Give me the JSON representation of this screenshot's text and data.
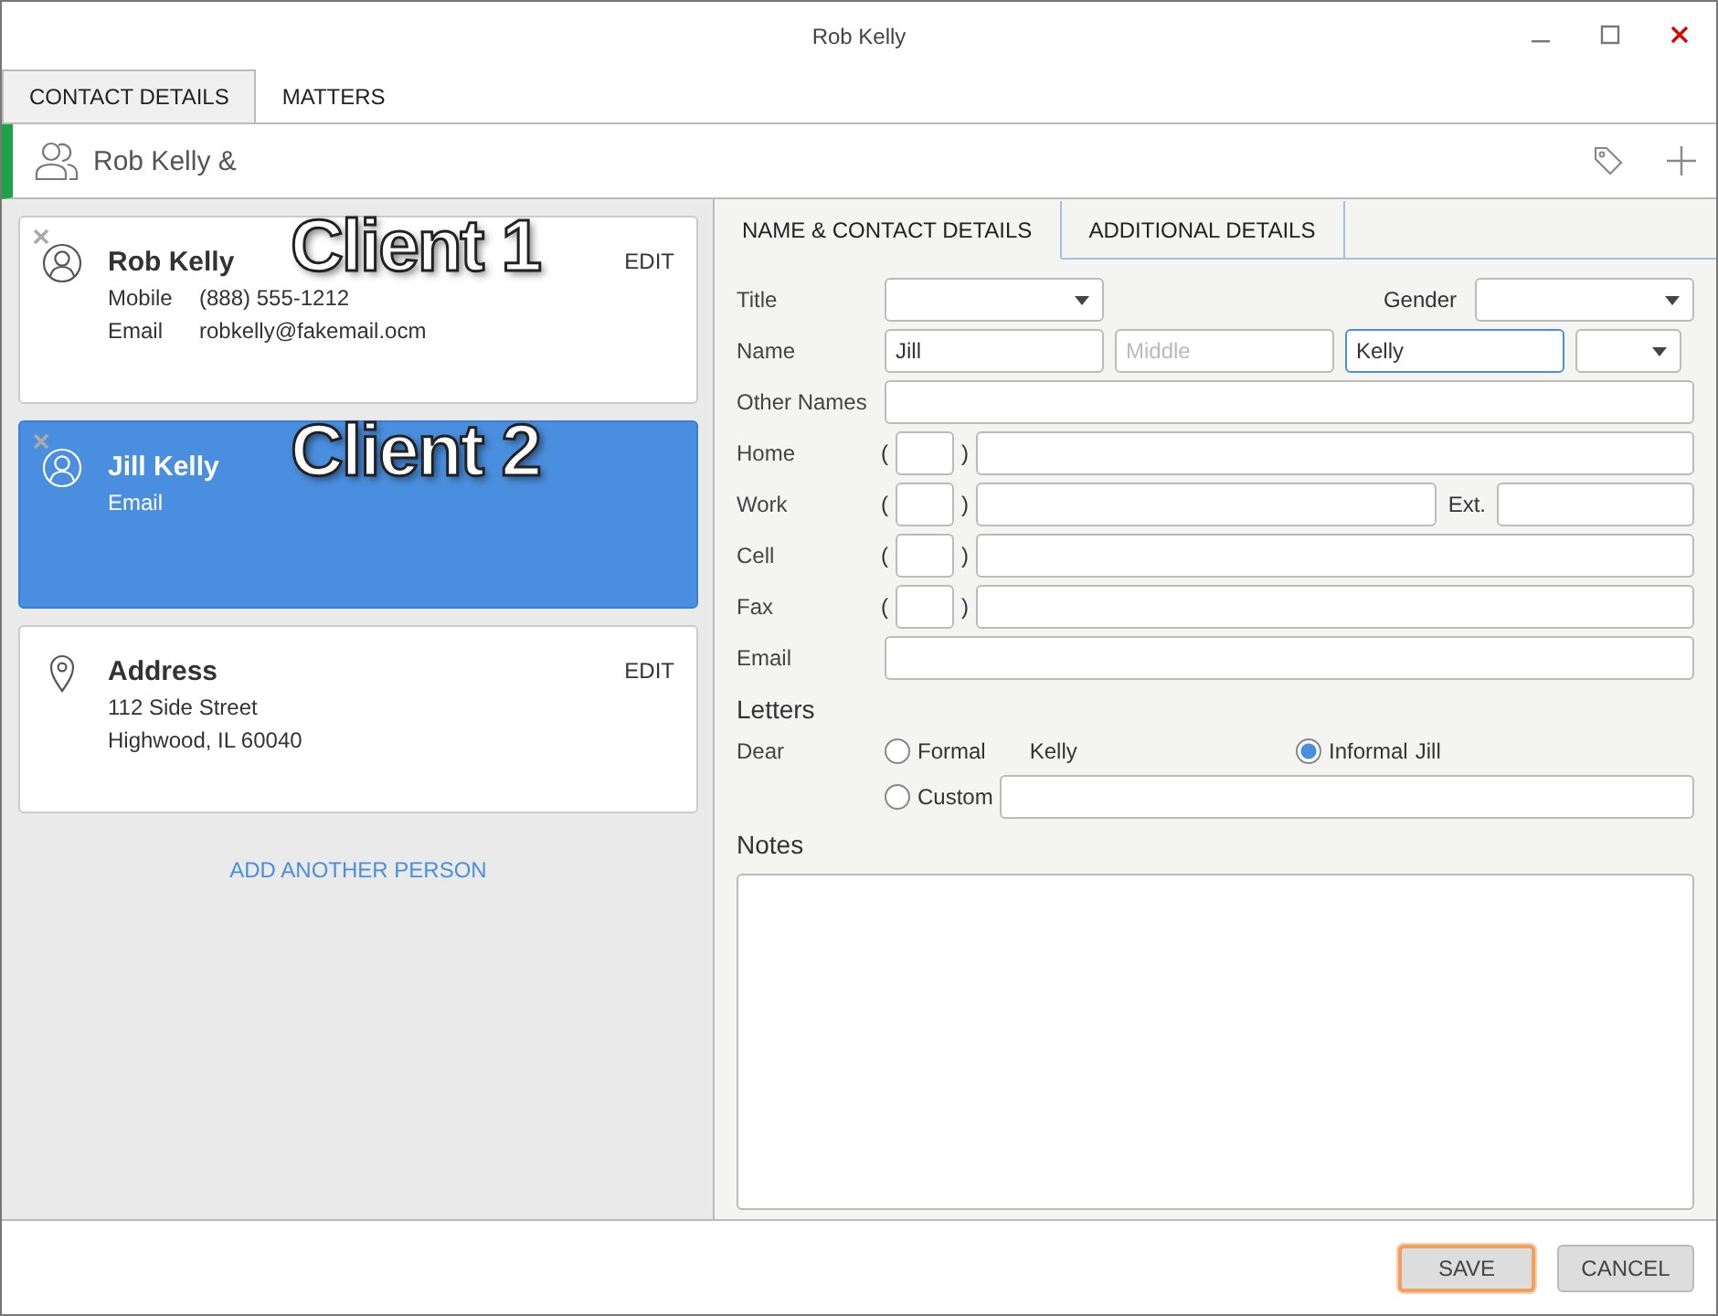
{
  "window": {
    "title": "Rob Kelly"
  },
  "tabs": [
    {
      "label": "CONTACT DETAILS",
      "selected": true
    },
    {
      "label": "MATTERS",
      "selected": false
    }
  ],
  "header": {
    "title": "Rob Kelly &"
  },
  "cards": [
    {
      "kind": "person",
      "name": "Rob Kelly",
      "selected": false,
      "annotation": "Client 1",
      "action": "EDIT",
      "details": [
        {
          "label": "Mobile",
          "value": "(888) 555-1212"
        },
        {
          "label": "Email",
          "value": "robkelly@fakemail.ocm"
        }
      ]
    },
    {
      "kind": "person",
      "name": "Jill Kelly",
      "selected": true,
      "annotation": "Client 2",
      "details": [
        {
          "label": "Email"
        }
      ]
    },
    {
      "kind": "address",
      "name": "Address",
      "selected": false,
      "action": "EDIT",
      "lines": [
        "112 Side Street",
        "Highwood, IL 60040"
      ]
    }
  ],
  "add_link": "ADD ANOTHER PERSON",
  "detail_tabs": [
    {
      "label": "NAME & CONTACT DETAILS",
      "selected": true
    },
    {
      "label": "ADDITIONAL DETAILS",
      "selected": false
    }
  ],
  "form": {
    "title_label": "Title",
    "gender_label": "Gender",
    "name_label": "Name",
    "name_fields": [
      {
        "value": "Jill",
        "focused": false
      },
      {
        "placeholder": "Middle",
        "focused": false
      },
      {
        "value": "Kelly",
        "focused": true
      }
    ],
    "other_names_label": "Other Names",
    "phones": [
      {
        "label": "Home",
        "open": "(",
        "close": ")"
      },
      {
        "label": "Work",
        "open": "(",
        "close": ")",
        "ext_label": "Ext."
      },
      {
        "label": "Cell",
        "open": "(",
        "close": ")"
      },
      {
        "label": "Fax",
        "open": "(",
        "close": ")"
      }
    ],
    "email_label": "Email"
  },
  "letters": {
    "heading": "Letters",
    "dear_label": "Dear",
    "options": [
      {
        "label": "Formal",
        "value": "Kelly",
        "selected": false
      },
      {
        "label": "Informal",
        "value": "Jill",
        "selected": true
      },
      {
        "label": "Custom",
        "selected": false
      }
    ]
  },
  "notes": {
    "heading": "Notes"
  },
  "buttons": [
    {
      "label": "SAVE",
      "focused": true
    },
    {
      "label": "CANCEL",
      "focused": false
    }
  ]
}
